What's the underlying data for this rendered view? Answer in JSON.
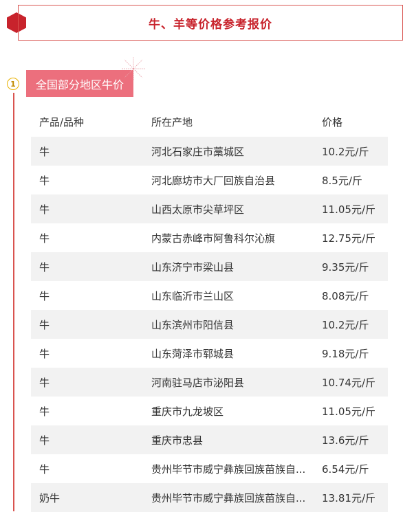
{
  "title": "牛、羊等价格参考报价",
  "section": {
    "step": "1",
    "label": "全国部分地区牛价"
  },
  "colors": {
    "accent_red": "#c8232c",
    "tag_pink": "#ec6f7d",
    "row_alt": "#f2f2f2",
    "step_yellow": "#e8b100"
  },
  "table": {
    "headers": [
      "产品/品种",
      "所在产地",
      "价格"
    ],
    "rows": [
      [
        "牛",
        "河北石家庄市藁城区",
        "10.2元/斤"
      ],
      [
        "牛",
        "河北廊坊市大厂回族自治县",
        "8.5元/斤"
      ],
      [
        "牛",
        "山西太原市尖草坪区",
        "11.05元/斤"
      ],
      [
        "牛",
        "内蒙古赤峰市阿鲁科尔沁旗",
        "12.75元/斤"
      ],
      [
        "牛",
        "山东济宁市梁山县",
        "9.35元/斤"
      ],
      [
        "牛",
        "山东临沂市兰山区",
        "8.08元/斤"
      ],
      [
        "牛",
        "山东滨州市阳信县",
        "10.2元/斤"
      ],
      [
        "牛",
        "山东菏泽市郓城县",
        "9.18元/斤"
      ],
      [
        "牛",
        "河南驻马店市泌阳县",
        "10.74元/斤"
      ],
      [
        "牛",
        "重庆市九龙坡区",
        "11.05元/斤"
      ],
      [
        "牛",
        "重庆市忠县",
        "13.6元/斤"
      ],
      [
        "牛",
        "贵州毕节市威宁彝族回族苗族自...",
        "6.54元/斤"
      ],
      [
        "奶牛",
        "贵州毕节市威宁彝族回族苗族自...",
        "13.81元/斤"
      ]
    ]
  }
}
